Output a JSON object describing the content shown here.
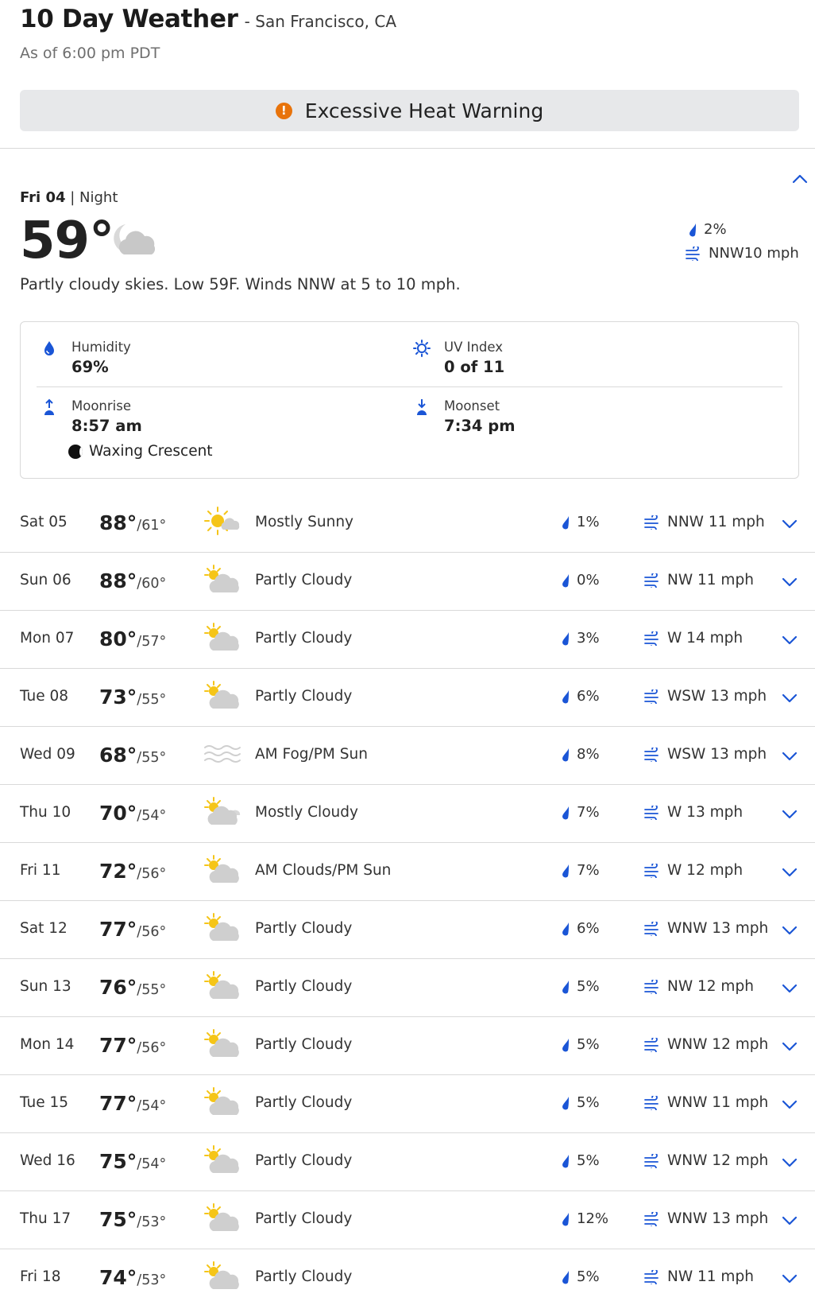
{
  "header": {
    "title": "10 Day Weather",
    "location": "- San Francisco, CA",
    "as_of": "As of 6:00 pm PDT"
  },
  "alert": {
    "icon": "exclamation-icon",
    "text": "Excessive Heat Warning",
    "color": "#e8730b"
  },
  "today": {
    "day": "Fri 04",
    "separator": " | ",
    "period": "Night",
    "temp": "59°",
    "icon": "partly-cloudy-night-icon",
    "precip": "2%",
    "wind": "NNW10 mph",
    "description": "Partly cloudy skies. Low 59F. Winds NNW at 5 to 10 mph.",
    "details": {
      "humidity_label": "Humidity",
      "humidity_value": "69%",
      "uv_label": "UV Index",
      "uv_value": "0 of 11",
      "moonrise_label": "Moonrise",
      "moonrise_value": "8:57 am",
      "moonset_label": "Moonset",
      "moonset_value": "7:34 pm",
      "moon_phase": "Waxing Crescent"
    }
  },
  "colors": {
    "accent": "#1a55d6",
    "sun": "#f5c518",
    "cloud": "#cfcfcf"
  },
  "days": [
    {
      "date": "Sat 05",
      "hi": "88°",
      "lo": "/61°",
      "icon": "mostly-sunny",
      "cond": "Mostly Sunny",
      "precip": "1%",
      "wind": "NNW 11 mph"
    },
    {
      "date": "Sun 06",
      "hi": "88°",
      "lo": "/60°",
      "icon": "partly-cloudy",
      "cond": "Partly Cloudy",
      "precip": "0%",
      "wind": "NW 11 mph"
    },
    {
      "date": "Mon 07",
      "hi": "80°",
      "lo": "/57°",
      "icon": "partly-cloudy",
      "cond": "Partly Cloudy",
      "precip": "3%",
      "wind": "W 14 mph"
    },
    {
      "date": "Tue 08",
      "hi": "73°",
      "lo": "/55°",
      "icon": "partly-cloudy",
      "cond": "Partly Cloudy",
      "precip": "6%",
      "wind": "WSW 13 mph"
    },
    {
      "date": "Wed 09",
      "hi": "68°",
      "lo": "/55°",
      "icon": "fog",
      "cond": "AM Fog/PM Sun",
      "precip": "8%",
      "wind": "WSW 13 mph"
    },
    {
      "date": "Thu 10",
      "hi": "70°",
      "lo": "/54°",
      "icon": "mostly-cloudy",
      "cond": "Mostly Cloudy",
      "precip": "7%",
      "wind": "W 13 mph"
    },
    {
      "date": "Fri 11",
      "hi": "72°",
      "lo": "/56°",
      "icon": "partly-cloudy",
      "cond": "AM Clouds/PM Sun",
      "precip": "7%",
      "wind": "W 12 mph"
    },
    {
      "date": "Sat 12",
      "hi": "77°",
      "lo": "/56°",
      "icon": "partly-cloudy",
      "cond": "Partly Cloudy",
      "precip": "6%",
      "wind": "WNW 13 mph"
    },
    {
      "date": "Sun 13",
      "hi": "76°",
      "lo": "/55°",
      "icon": "partly-cloudy",
      "cond": "Partly Cloudy",
      "precip": "5%",
      "wind": "NW 12 mph"
    },
    {
      "date": "Mon 14",
      "hi": "77°",
      "lo": "/56°",
      "icon": "partly-cloudy",
      "cond": "Partly Cloudy",
      "precip": "5%",
      "wind": "WNW 12 mph"
    },
    {
      "date": "Tue 15",
      "hi": "77°",
      "lo": "/54°",
      "icon": "partly-cloudy",
      "cond": "Partly Cloudy",
      "precip": "5%",
      "wind": "WNW 11 mph"
    },
    {
      "date": "Wed 16",
      "hi": "75°",
      "lo": "/54°",
      "icon": "partly-cloudy",
      "cond": "Partly Cloudy",
      "precip": "5%",
      "wind": "WNW 12 mph"
    },
    {
      "date": "Thu 17",
      "hi": "75°",
      "lo": "/53°",
      "icon": "partly-cloudy",
      "cond": "Partly Cloudy",
      "precip": "12%",
      "wind": "WNW 13 mph"
    },
    {
      "date": "Fri 18",
      "hi": "74°",
      "lo": "/53°",
      "icon": "partly-cloudy",
      "cond": "Partly Cloudy",
      "precip": "5%",
      "wind": "NW 11 mph"
    }
  ]
}
